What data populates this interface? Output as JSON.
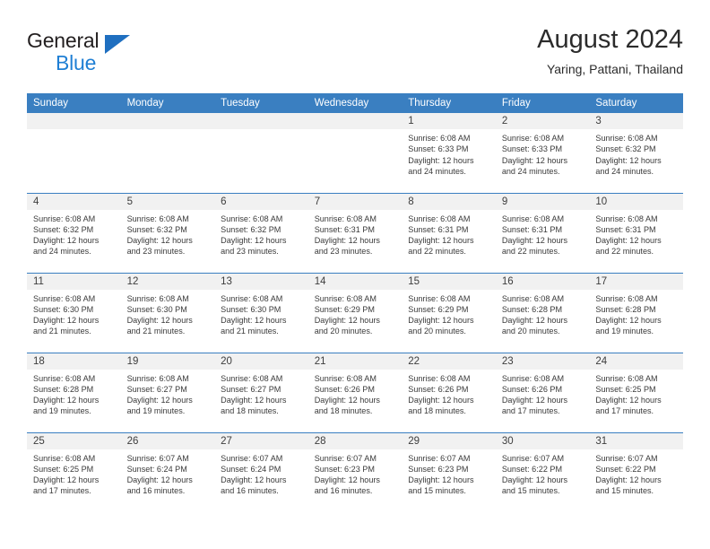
{
  "brand": {
    "name_top": "General",
    "name_bottom": "Blue",
    "accent_color": "#1f7fd4",
    "triangle_color": "#1f6fc0"
  },
  "header": {
    "title": "August 2024",
    "subtitle": "Yaring, Pattani, Thailand"
  },
  "calendar": {
    "header_bg": "#3a7fc1",
    "daynum_bg": "#f1f1f1",
    "weekday_labels": [
      "Sunday",
      "Monday",
      "Tuesday",
      "Wednesday",
      "Thursday",
      "Friday",
      "Saturday"
    ],
    "labels": {
      "sunrise": "Sunrise:",
      "sunset": "Sunset:",
      "daylight": "Daylight:"
    },
    "weeks": [
      [
        {
          "day": "",
          "sunrise": "",
          "sunset": "",
          "daylight_line1": "",
          "daylight_line2": "",
          "empty": true
        },
        {
          "day": "",
          "sunrise": "",
          "sunset": "",
          "daylight_line1": "",
          "daylight_line2": "",
          "empty": true
        },
        {
          "day": "",
          "sunrise": "",
          "sunset": "",
          "daylight_line1": "",
          "daylight_line2": "",
          "empty": true
        },
        {
          "day": "",
          "sunrise": "",
          "sunset": "",
          "daylight_line1": "",
          "daylight_line2": "",
          "empty": true
        },
        {
          "day": "1",
          "sunrise": "Sunrise: 6:08 AM",
          "sunset": "Sunset: 6:33 PM",
          "daylight_line1": "Daylight: 12 hours",
          "daylight_line2": "and 24 minutes."
        },
        {
          "day": "2",
          "sunrise": "Sunrise: 6:08 AM",
          "sunset": "Sunset: 6:33 PM",
          "daylight_line1": "Daylight: 12 hours",
          "daylight_line2": "and 24 minutes."
        },
        {
          "day": "3",
          "sunrise": "Sunrise: 6:08 AM",
          "sunset": "Sunset: 6:32 PM",
          "daylight_line1": "Daylight: 12 hours",
          "daylight_line2": "and 24 minutes."
        }
      ],
      [
        {
          "day": "4",
          "sunrise": "Sunrise: 6:08 AM",
          "sunset": "Sunset: 6:32 PM",
          "daylight_line1": "Daylight: 12 hours",
          "daylight_line2": "and 24 minutes."
        },
        {
          "day": "5",
          "sunrise": "Sunrise: 6:08 AM",
          "sunset": "Sunset: 6:32 PM",
          "daylight_line1": "Daylight: 12 hours",
          "daylight_line2": "and 23 minutes."
        },
        {
          "day": "6",
          "sunrise": "Sunrise: 6:08 AM",
          "sunset": "Sunset: 6:32 PM",
          "daylight_line1": "Daylight: 12 hours",
          "daylight_line2": "and 23 minutes."
        },
        {
          "day": "7",
          "sunrise": "Sunrise: 6:08 AM",
          "sunset": "Sunset: 6:31 PM",
          "daylight_line1": "Daylight: 12 hours",
          "daylight_line2": "and 23 minutes."
        },
        {
          "day": "8",
          "sunrise": "Sunrise: 6:08 AM",
          "sunset": "Sunset: 6:31 PM",
          "daylight_line1": "Daylight: 12 hours",
          "daylight_line2": "and 22 minutes."
        },
        {
          "day": "9",
          "sunrise": "Sunrise: 6:08 AM",
          "sunset": "Sunset: 6:31 PM",
          "daylight_line1": "Daylight: 12 hours",
          "daylight_line2": "and 22 minutes."
        },
        {
          "day": "10",
          "sunrise": "Sunrise: 6:08 AM",
          "sunset": "Sunset: 6:31 PM",
          "daylight_line1": "Daylight: 12 hours",
          "daylight_line2": "and 22 minutes."
        }
      ],
      [
        {
          "day": "11",
          "sunrise": "Sunrise: 6:08 AM",
          "sunset": "Sunset: 6:30 PM",
          "daylight_line1": "Daylight: 12 hours",
          "daylight_line2": "and 21 minutes."
        },
        {
          "day": "12",
          "sunrise": "Sunrise: 6:08 AM",
          "sunset": "Sunset: 6:30 PM",
          "daylight_line1": "Daylight: 12 hours",
          "daylight_line2": "and 21 minutes."
        },
        {
          "day": "13",
          "sunrise": "Sunrise: 6:08 AM",
          "sunset": "Sunset: 6:30 PM",
          "daylight_line1": "Daylight: 12 hours",
          "daylight_line2": "and 21 minutes."
        },
        {
          "day": "14",
          "sunrise": "Sunrise: 6:08 AM",
          "sunset": "Sunset: 6:29 PM",
          "daylight_line1": "Daylight: 12 hours",
          "daylight_line2": "and 20 minutes."
        },
        {
          "day": "15",
          "sunrise": "Sunrise: 6:08 AM",
          "sunset": "Sunset: 6:29 PM",
          "daylight_line1": "Daylight: 12 hours",
          "daylight_line2": "and 20 minutes."
        },
        {
          "day": "16",
          "sunrise": "Sunrise: 6:08 AM",
          "sunset": "Sunset: 6:28 PM",
          "daylight_line1": "Daylight: 12 hours",
          "daylight_line2": "and 20 minutes."
        },
        {
          "day": "17",
          "sunrise": "Sunrise: 6:08 AM",
          "sunset": "Sunset: 6:28 PM",
          "daylight_line1": "Daylight: 12 hours",
          "daylight_line2": "and 19 minutes."
        }
      ],
      [
        {
          "day": "18",
          "sunrise": "Sunrise: 6:08 AM",
          "sunset": "Sunset: 6:28 PM",
          "daylight_line1": "Daylight: 12 hours",
          "daylight_line2": "and 19 minutes."
        },
        {
          "day": "19",
          "sunrise": "Sunrise: 6:08 AM",
          "sunset": "Sunset: 6:27 PM",
          "daylight_line1": "Daylight: 12 hours",
          "daylight_line2": "and 19 minutes."
        },
        {
          "day": "20",
          "sunrise": "Sunrise: 6:08 AM",
          "sunset": "Sunset: 6:27 PM",
          "daylight_line1": "Daylight: 12 hours",
          "daylight_line2": "and 18 minutes."
        },
        {
          "day": "21",
          "sunrise": "Sunrise: 6:08 AM",
          "sunset": "Sunset: 6:26 PM",
          "daylight_line1": "Daylight: 12 hours",
          "daylight_line2": "and 18 minutes."
        },
        {
          "day": "22",
          "sunrise": "Sunrise: 6:08 AM",
          "sunset": "Sunset: 6:26 PM",
          "daylight_line1": "Daylight: 12 hours",
          "daylight_line2": "and 18 minutes."
        },
        {
          "day": "23",
          "sunrise": "Sunrise: 6:08 AM",
          "sunset": "Sunset: 6:26 PM",
          "daylight_line1": "Daylight: 12 hours",
          "daylight_line2": "and 17 minutes."
        },
        {
          "day": "24",
          "sunrise": "Sunrise: 6:08 AM",
          "sunset": "Sunset: 6:25 PM",
          "daylight_line1": "Daylight: 12 hours",
          "daylight_line2": "and 17 minutes."
        }
      ],
      [
        {
          "day": "25",
          "sunrise": "Sunrise: 6:08 AM",
          "sunset": "Sunset: 6:25 PM",
          "daylight_line1": "Daylight: 12 hours",
          "daylight_line2": "and 17 minutes."
        },
        {
          "day": "26",
          "sunrise": "Sunrise: 6:07 AM",
          "sunset": "Sunset: 6:24 PM",
          "daylight_line1": "Daylight: 12 hours",
          "daylight_line2": "and 16 minutes."
        },
        {
          "day": "27",
          "sunrise": "Sunrise: 6:07 AM",
          "sunset": "Sunset: 6:24 PM",
          "daylight_line1": "Daylight: 12 hours",
          "daylight_line2": "and 16 minutes."
        },
        {
          "day": "28",
          "sunrise": "Sunrise: 6:07 AM",
          "sunset": "Sunset: 6:23 PM",
          "daylight_line1": "Daylight: 12 hours",
          "daylight_line2": "and 16 minutes."
        },
        {
          "day": "29",
          "sunrise": "Sunrise: 6:07 AM",
          "sunset": "Sunset: 6:23 PM",
          "daylight_line1": "Daylight: 12 hours",
          "daylight_line2": "and 15 minutes."
        },
        {
          "day": "30",
          "sunrise": "Sunrise: 6:07 AM",
          "sunset": "Sunset: 6:22 PM",
          "daylight_line1": "Daylight: 12 hours",
          "daylight_line2": "and 15 minutes."
        },
        {
          "day": "31",
          "sunrise": "Sunrise: 6:07 AM",
          "sunset": "Sunset: 6:22 PM",
          "daylight_line1": "Daylight: 12 hours",
          "daylight_line2": "and 15 minutes."
        }
      ]
    ]
  }
}
